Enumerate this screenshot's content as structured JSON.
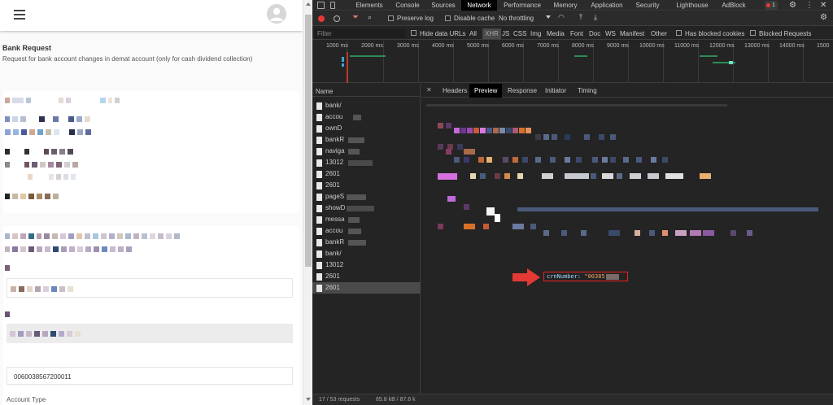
{
  "app": {
    "title": "Bank Request",
    "subtitle": "Request for bank account changes in demat account (only for cash dividend collection)",
    "account_value": "0060038567200011",
    "account_type_label": "Account Type"
  },
  "devtools": {
    "tabs": [
      "Elements",
      "Console",
      "Sources",
      "Network",
      "Performance",
      "Memory",
      "Application",
      "Security",
      "Lighthouse",
      "AdBlock"
    ],
    "active_tab": "Network",
    "error_count": "1",
    "toolbar": {
      "preserve_log": "Preserve log",
      "disable_cache": "Disable cache",
      "throttling": "No throttling"
    },
    "filter": {
      "placeholder": "Filter",
      "hide_data_urls": "Hide data URLs",
      "types": [
        "All",
        "XHR",
        "JS",
        "CSS",
        "Img",
        "Media",
        "Font",
        "Doc",
        "WS",
        "Manifest",
        "Other"
      ],
      "active_type": "XHR",
      "has_blocked_cookies": "Has blocked cookies",
      "blocked_requests": "Blocked Requests"
    },
    "timeline_ticks": [
      "1000 ms",
      "2000 ms",
      "3000 ms",
      "4000 ms",
      "5000 ms",
      "6000 ms",
      "7000 ms",
      "8000 ms",
      "9000 ms",
      "10000 ms",
      "11000 ms",
      "12000 ms",
      "13000 ms",
      "14000 ms",
      "1500"
    ],
    "request_list_header": "Name",
    "requests": [
      "bank/",
      "accou",
      "ownD",
      "bankR",
      "naviga",
      "13012",
      "2601",
      "2601",
      "pageS",
      "showD",
      "messa",
      "accou",
      "bankR",
      "bank/",
      "13012",
      "2601",
      "2601"
    ],
    "selected_request_index": 16,
    "detail_tabs": [
      "Headers",
      "Preview",
      "Response",
      "Initiator",
      "Timing"
    ],
    "active_detail_tab": "Preview",
    "highlight": {
      "key": "crnNumber:",
      "value": "\"00385"
    },
    "status": {
      "requests": "17 / 53 requests",
      "transferred": "65.8 kB / 87.6 k"
    }
  },
  "colors": {
    "devtools_bg": "#242424",
    "active_tab_bg": "#000000",
    "highlight_red": "#e22222",
    "timeline_marker": "#c0392b"
  }
}
